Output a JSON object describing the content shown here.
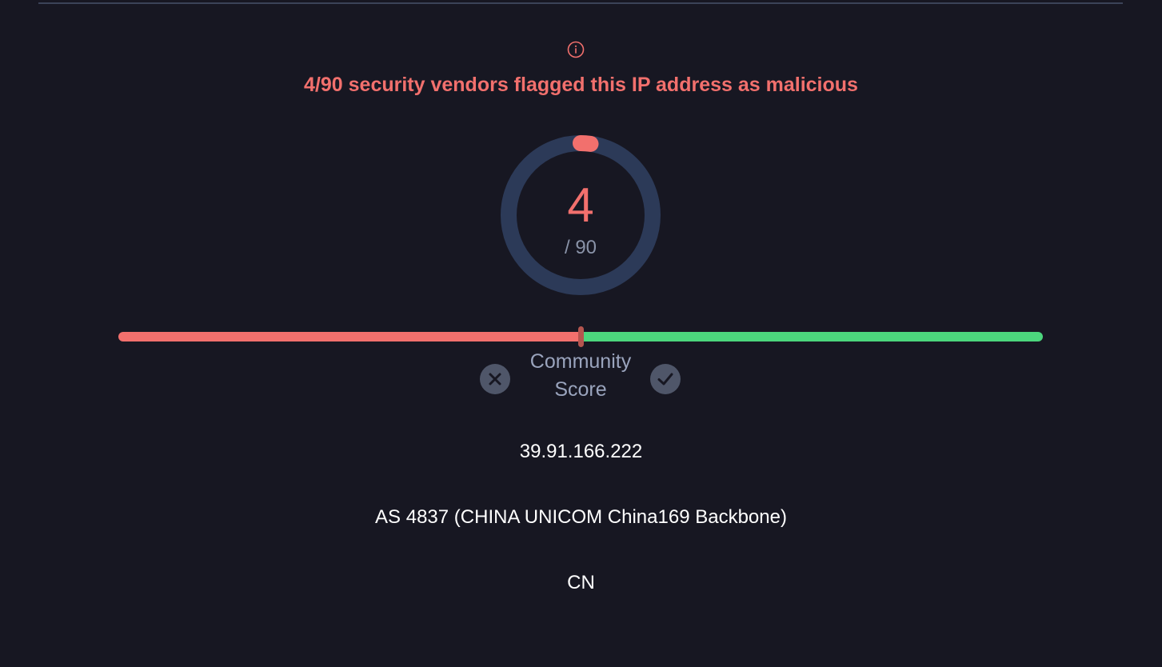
{
  "detection": {
    "headline": "4/90 security vendors flagged this IP address as malicious",
    "malicious": 4,
    "total": 90,
    "total_label": "/ 90",
    "color_malicious": "#f2706d",
    "color_ring": "#2c3a58"
  },
  "community_score": {
    "label_line1": "Community",
    "label_line2": "Score",
    "score_fraction": 0.5,
    "color_bad": "#f2706d",
    "color_good": "#4cd67d",
    "vote_down_icon": "close-icon",
    "vote_up_icon": "check-icon"
  },
  "ip_info": {
    "address": "39.91.166.222",
    "asn": "AS 4837 (CHINA UNICOM China169 Backbone)",
    "country": "CN"
  }
}
